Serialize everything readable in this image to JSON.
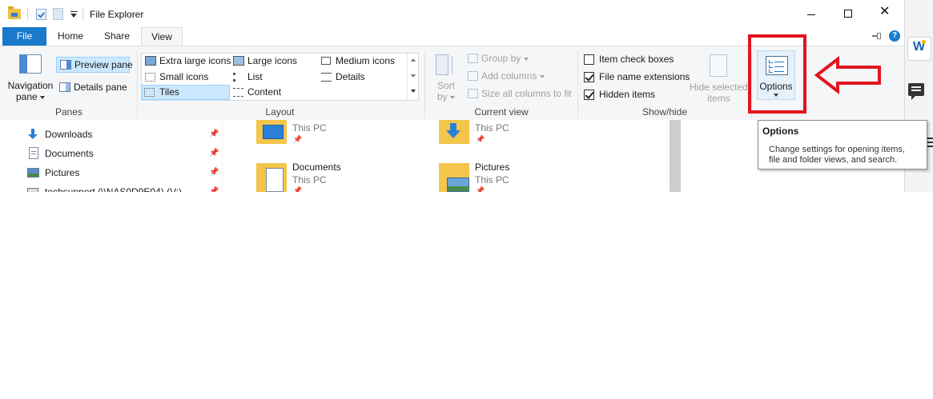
{
  "window": {
    "title": "File Explorer"
  },
  "ribbon_tabs": [
    {
      "label": "File"
    },
    {
      "label": "Home"
    },
    {
      "label": "Share"
    },
    {
      "label": "View"
    }
  ],
  "panes": {
    "navigation_pane": "Navigation",
    "navigation_pane_2": "pane",
    "preview_pane": "Preview pane",
    "details_pane": "Details pane",
    "group_label": "Panes"
  },
  "layout": {
    "extra_large": "Extra large icons",
    "large": "Large icons",
    "medium": "Medium icons",
    "small": "Small icons",
    "list": "List",
    "details": "Details",
    "tiles": "Tiles",
    "content": "Content",
    "group_label": "Layout"
  },
  "current_view": {
    "sort": "Sort",
    "sort_2": "by",
    "group_by": "Group by",
    "add_columns": "Add columns",
    "size_all": "Size all columns to fit",
    "group_label": "Current view"
  },
  "show_hide": {
    "item_check_boxes": "Item check boxes",
    "item_check_boxes_checked": false,
    "file_name_extensions": "File name extensions",
    "file_name_extensions_checked": true,
    "hidden_items": "Hidden items",
    "hidden_items_checked": true,
    "hide_selected": "Hide selected",
    "hide_selected_2": "items",
    "group_label": "Show/hide"
  },
  "options": {
    "label": "Options"
  },
  "tooltip": {
    "title": "Options",
    "line1": "Change settings for opening items,",
    "line2": "file and folder views, and search."
  },
  "nav_items": [
    {
      "label": "Downloads",
      "icon": "downloads-icon"
    },
    {
      "label": "Documents",
      "icon": "documents-icon"
    },
    {
      "label": "Pictures",
      "icon": "pictures-icon"
    },
    {
      "label": "techsupport (\\\\NAS0D9E04) (V:)",
      "icon": "network-drive-icon"
    }
  ],
  "tiles": [
    {
      "name": "",
      "location": "This PC"
    },
    {
      "name": "",
      "location": "This PC"
    },
    {
      "name": "Documents",
      "location": "This PC"
    },
    {
      "name": "Pictures",
      "location": "This PC"
    }
  ],
  "colors": {
    "accent": "#1979ca",
    "annotation_red": "#e2151e",
    "selected_bg": "#cce8ff",
    "selected_border": "#99d1ff"
  },
  "edge_glyph": "W"
}
